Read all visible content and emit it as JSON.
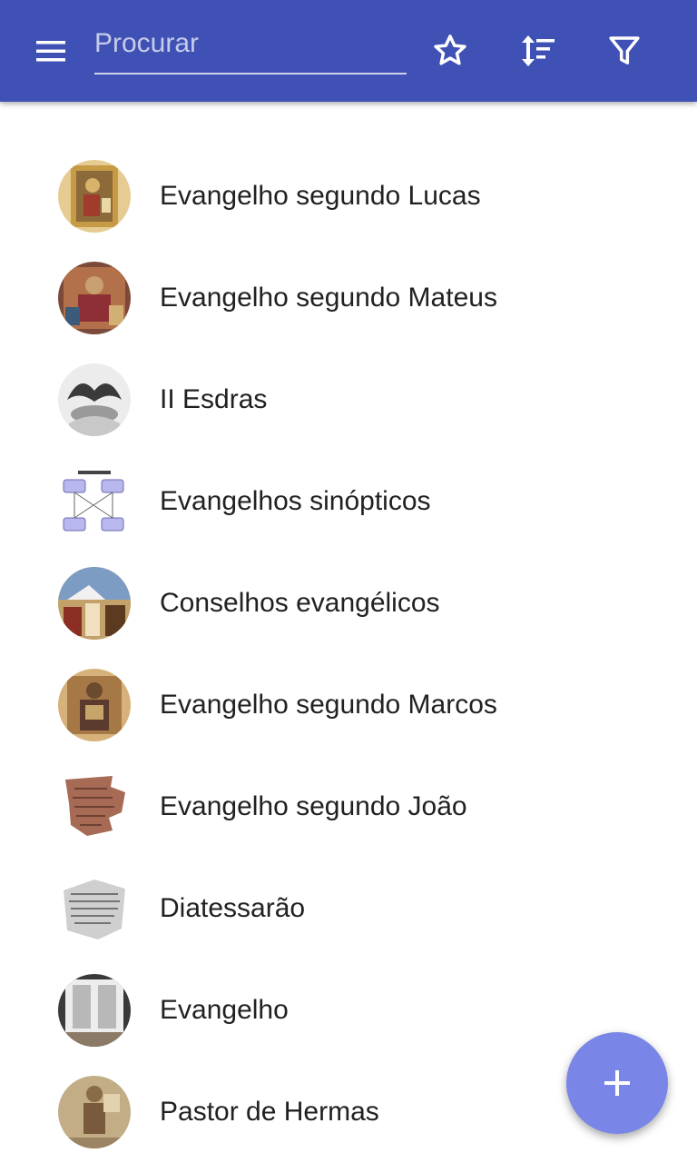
{
  "header": {
    "search_placeholder": "Procurar",
    "icons": [
      "menu-icon",
      "star-outline-icon",
      "sort-icon",
      "filter-icon"
    ],
    "color": "#3f51b5"
  },
  "items": [
    {
      "label": "Evangelho segundo Lucas",
      "thumb": "manuscript-illumination-thumbnail"
    },
    {
      "label": "Evangelho segundo Mateus",
      "thumb": "manuscript-illumination-thumbnail"
    },
    {
      "label": "II Esdras",
      "thumb": "engraving-thumbnail"
    },
    {
      "label": "Evangelhos sinópticos",
      "thumb": "diagram-thumbnail"
    },
    {
      "label": "Conselhos evangélicos",
      "thumb": "painting-thumbnail"
    },
    {
      "label": "Evangelho segundo Marcos",
      "thumb": "manuscript-illumination-thumbnail"
    },
    {
      "label": "Evangelho segundo João",
      "thumb": "papyrus-thumbnail"
    },
    {
      "label": "Diatessarão",
      "thumb": "fragment-thumbnail"
    },
    {
      "label": "Evangelho",
      "thumb": "book-thumbnail"
    },
    {
      "label": "Pastor de Hermas",
      "thumb": "fresco-thumbnail"
    }
  ],
  "fab": {
    "icon": "plus-icon",
    "color": "#7986e8"
  }
}
